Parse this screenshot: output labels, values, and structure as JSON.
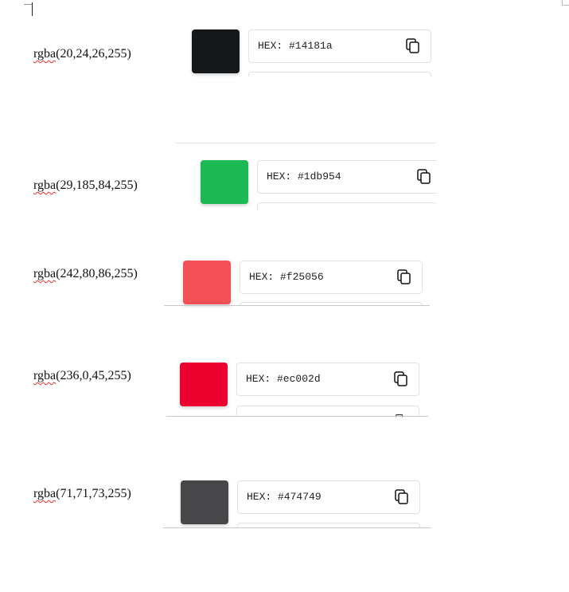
{
  "rows": [
    {
      "rgba": "rgba(20,24,26,255)",
      "rgba_fn": "rgba",
      "rgba_args": "(20,24,26,255)",
      "hex_label": "HEX: #14181a",
      "color": "#14181a"
    },
    {
      "rgba": "rgba(29,185,84,255)",
      "rgba_fn": "rgba",
      "rgba_args": "(29,185,84,255)",
      "hex_label": "HEX: #1db954",
      "color": "#1db954"
    },
    {
      "rgba": "rgba(242,80,86,255)",
      "rgba_fn": "rgba",
      "rgba_args": "(242,80,86,255)",
      "hex_label": "HEX: #f25056",
      "color": "#f25056"
    },
    {
      "rgba": "rgba(236,0,45,255)",
      "rgba_fn": "rgba",
      "rgba_args": "(236,0,45,255)",
      "hex_label": "HEX: #ec002d",
      "color": "#ec002d"
    },
    {
      "rgba": "rgba(71,71,73,255)",
      "rgba_fn": "rgba",
      "rgba_args": "(71,71,73,255)",
      "hex_label": "HEX: #474749",
      "color": "#474749"
    }
  ],
  "icons": {
    "copy": "copy-icon"
  }
}
